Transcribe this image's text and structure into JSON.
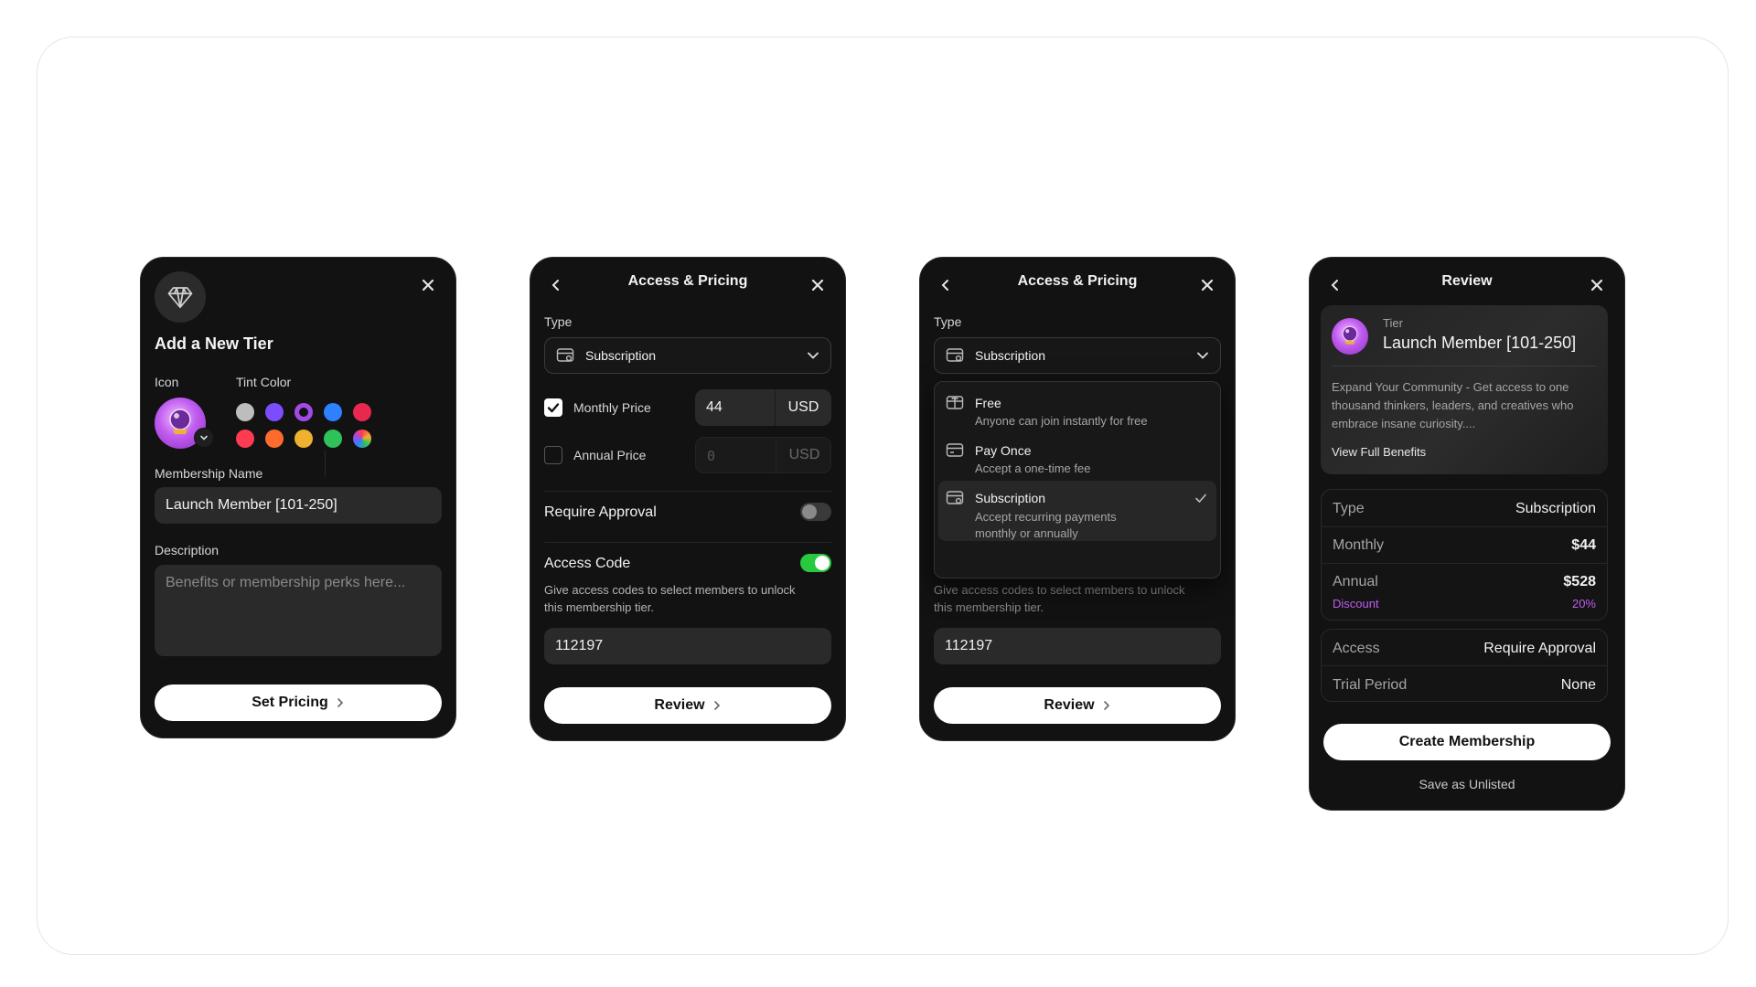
{
  "colors": {
    "accent_green": "#28c840",
    "accent_purple": "#c05cf0",
    "card_bg": "#121212"
  },
  "card1": {
    "title": "Add a New Tier",
    "icon_label": "Icon",
    "tint_label": "Tint Color",
    "name_label": "Membership Name",
    "name_value": "Launch Member [101-250]",
    "description_label": "Description",
    "description_placeholder": "Benefits or membership perks here...",
    "button": "Set Pricing",
    "tint_colors": [
      "#bdbdbd",
      "#7c4dff",
      "#a24ae6",
      "#2f80ff",
      "#e8284f",
      "#ff3b52",
      "#ff6b2c",
      "#f0b030",
      "#2fc25b"
    ]
  },
  "card2": {
    "title": "Access & Pricing",
    "type_label": "Type",
    "type_value": "Subscription",
    "monthly_label": "Monthly Price",
    "monthly_value": "44",
    "monthly_currency": "USD",
    "annual_label": "Annual Price",
    "annual_placeholder": "0",
    "annual_currency": "USD",
    "approval_label": "Require Approval",
    "access_label": "Access Code",
    "access_desc": "Give access codes to select members to unlock this membership tier.",
    "access_code": "112197",
    "button": "Review"
  },
  "card3": {
    "title": "Access & Pricing",
    "type_label": "Type",
    "type_value": "Subscription",
    "options": [
      {
        "title": "Free",
        "desc": "Anyone can join instantly for free"
      },
      {
        "title": "Pay Once",
        "desc": "Accept a one-time fee"
      },
      {
        "title": "Subscription",
        "desc": "Accept recurring payments monthly or annually"
      }
    ],
    "access_desc": "Give access codes to select members to unlock this membership tier.",
    "access_code": "112197",
    "button": "Review"
  },
  "card4": {
    "title": "Review",
    "tier_label": "Tier",
    "tier_name": "Launch Member [101-250]",
    "tier_desc": "Expand Your Community - Get access to one thousand thinkers, leaders, and creatives who embrace insane curiosity....",
    "view_benefits": "View Full Benefits",
    "type_label": "Type",
    "type_value": "Subscription",
    "monthly_label": "Monthly",
    "monthly_value": "$44",
    "annual_label": "Annual",
    "annual_value": "$528",
    "discount_label": "Discount",
    "discount_value": "20%",
    "access_label": "Access",
    "access_value": "Require Approval",
    "trial_label": "Trial Period",
    "trial_value": "None",
    "create_button": "Create Membership",
    "save_unlisted": "Save as Unlisted"
  }
}
